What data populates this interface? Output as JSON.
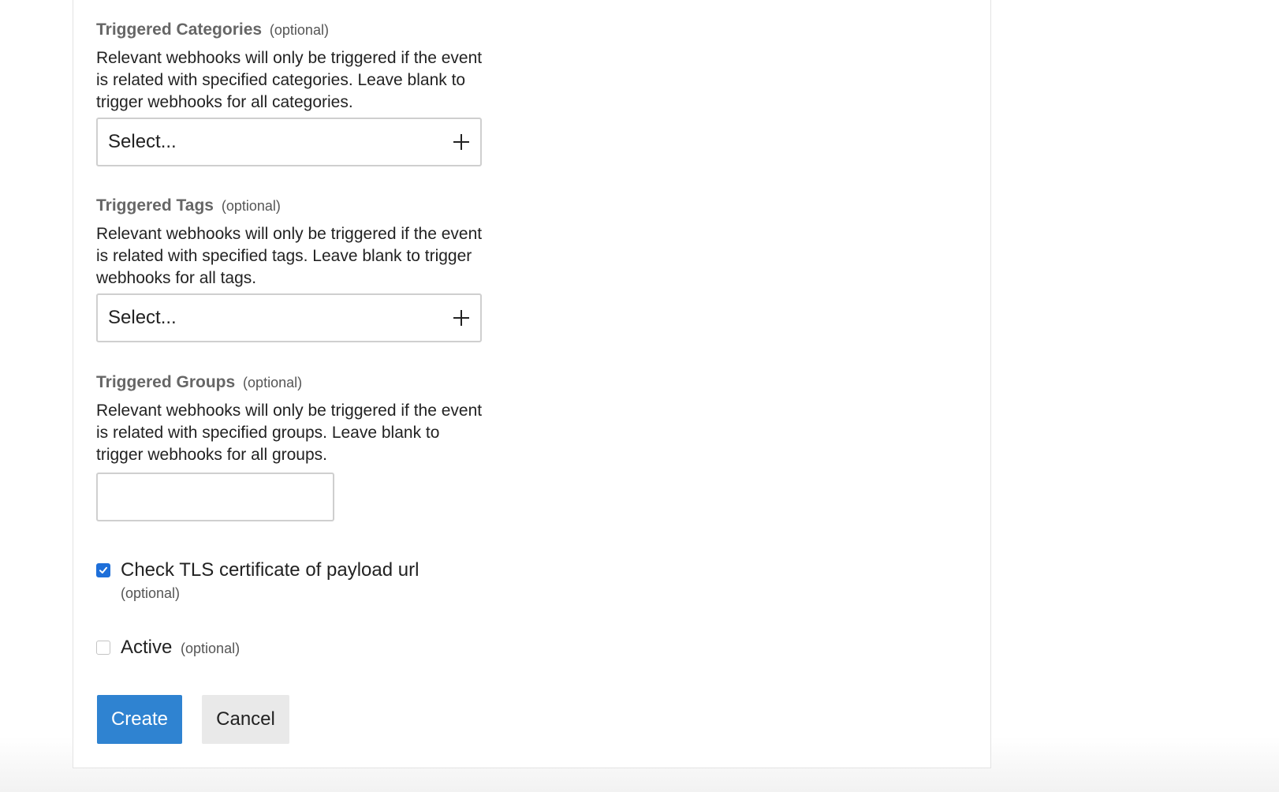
{
  "form": {
    "categories": {
      "label": "Triggered Categories",
      "optional": "(optional)",
      "description": "Relevant webhooks will only be triggered if the event is related with specified categories. Leave blank to trigger webhooks for all categories.",
      "placeholder": "Select..."
    },
    "tags": {
      "label": "Triggered Tags",
      "optional": "(optional)",
      "description": "Relevant webhooks will only be triggered if the event is related with specified tags. Leave blank to trigger webhooks for all tags.",
      "placeholder": "Select..."
    },
    "groups": {
      "label": "Triggered Groups",
      "optional": "(optional)",
      "description": "Relevant webhooks will only be triggered if the event is related with specified groups. Leave blank to trigger webhooks for all groups.",
      "value": ""
    },
    "tls_check": {
      "label": "Check TLS certificate of payload url",
      "optional": "(optional)",
      "checked": true
    },
    "active": {
      "label": "Active",
      "optional": "(optional)",
      "checked": false
    },
    "buttons": {
      "create": "Create",
      "cancel": "Cancel"
    }
  },
  "colors": {
    "primary_button": "#2f83d1",
    "checkbox_checked": "#1e6fd9",
    "secondary_button": "#e9e9e9"
  },
  "icons": {
    "select_add": "plus-icon",
    "checkbox_tick": "checkmark-icon"
  }
}
